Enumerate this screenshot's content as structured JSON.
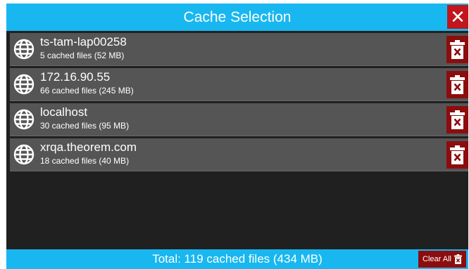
{
  "dialog": {
    "title": "Cache Selection",
    "close_label": "✕"
  },
  "caches": [
    {
      "host": "ts-tam-lap00258",
      "info": "5 cached files (52 MB)"
    },
    {
      "host": "172.16.90.55",
      "info": "66 cached files (245 MB)"
    },
    {
      "host": "localhost",
      "info": "30 cached files (95 MB)"
    },
    {
      "host": "xrqa.theorem.com",
      "info": "18 cached files (40 MB)"
    }
  ],
  "footer": {
    "total": "Total: 119 cached files (434 MB)",
    "clear_all_label": "Clear All"
  },
  "colors": {
    "accent": "#18b7f0",
    "danger": "#8c0d0d",
    "close": "#c0161c",
    "row": "#555555",
    "panel": "#202020"
  },
  "icons": {
    "row_icon": "globe-icon",
    "delete_icon": "trash-x-icon",
    "close_icon": "close-icon"
  }
}
